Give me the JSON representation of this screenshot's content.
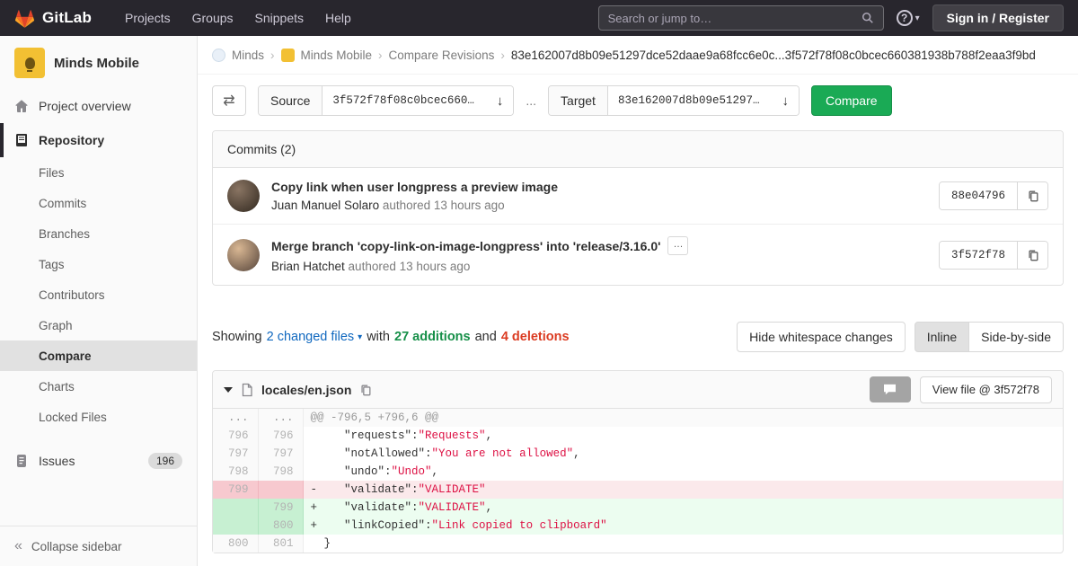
{
  "colors": {
    "navbar_bg": "#28262d",
    "accent_green": "#1aaa55",
    "link_blue": "#1068bf",
    "addition_green": "#168f48",
    "deletion_red": "#db3b21",
    "avatar_yellow": "#f2c033"
  },
  "navbar": {
    "brand": "GitLab",
    "menu": [
      "Projects",
      "Groups",
      "Snippets",
      "Help"
    ],
    "search_placeholder": "Search or jump to…",
    "auth_button": "Sign in / Register"
  },
  "sidebar": {
    "project_name": "Minds Mobile",
    "overview_label": "Project overview",
    "repository_label": "Repository",
    "repository_items": [
      "Files",
      "Commits",
      "Branches",
      "Tags",
      "Contributors",
      "Graph",
      "Compare",
      "Charts",
      "Locked Files"
    ],
    "active_item": "Compare",
    "issues_label": "Issues",
    "issues_count": "196",
    "collapse_label": "Collapse sidebar"
  },
  "breadcrumb": {
    "items": [
      "Minds",
      "Minds Mobile",
      "Compare Revisions"
    ],
    "current": "83e162007d8b09e51297dce52daae9a68fcc6e0c...3f572f78f08c0bcec660381938b788f2eaa3f9bd"
  },
  "compare_form": {
    "source_label": "Source",
    "source_value": "3f572f78f08c0bcec660…",
    "separator": "...",
    "target_label": "Target",
    "target_value": "83e162007d8b09e51297…",
    "compare_button": "Compare"
  },
  "commits": {
    "header": "Commits (2)",
    "items": [
      {
        "title": "Copy link when user longpress a preview image",
        "author": "Juan Manuel Solaro",
        "meta": "authored 13 hours ago",
        "sha": "88e04796",
        "expander": false
      },
      {
        "title": "Merge branch 'copy-link-on-image-longpress' into 'release/3.16.0'",
        "author": "Brian Hatchet",
        "meta": "authored 13 hours ago",
        "sha": "3f572f78",
        "expander": true
      }
    ]
  },
  "diff_summary": {
    "showing": "Showing",
    "files_link": "2 changed files",
    "with_label": "with",
    "additions": "27 additions",
    "and_label": "and",
    "deletions": "4 deletions",
    "whitespace_button": "Hide whitespace changes",
    "inline_button": "Inline",
    "side_by_side_button": "Side-by-side"
  },
  "file_diff": {
    "file_name": "locales/en.json",
    "view_file_button": "View file @ 3f572f78",
    "lines": [
      {
        "type": "hunk",
        "old": "...",
        "new": "...",
        "sign": "",
        "parts": [
          [
            "h",
            "@@ -796,5 +796,6 @@"
          ]
        ]
      },
      {
        "type": "ctx",
        "old": "796",
        "new": "796",
        "sign": "",
        "parts": [
          [
            "k",
            "   \"requests\""
          ],
          [
            "p",
            ":"
          ],
          [
            "s",
            "\"Requests\""
          ],
          [
            "p",
            ","
          ]
        ]
      },
      {
        "type": "ctx",
        "old": "797",
        "new": "797",
        "sign": "",
        "parts": [
          [
            "k",
            "   \"notAllowed\""
          ],
          [
            "p",
            ":"
          ],
          [
            "s",
            "\"You are not allowed\""
          ],
          [
            "p",
            ","
          ]
        ]
      },
      {
        "type": "ctx",
        "old": "798",
        "new": "798",
        "sign": "",
        "parts": [
          [
            "k",
            "   \"undo\""
          ],
          [
            "p",
            ":"
          ],
          [
            "s",
            "\"Undo\""
          ],
          [
            "p",
            ","
          ]
        ]
      },
      {
        "type": "del",
        "old": "799",
        "new": "",
        "sign": "-",
        "parts": [
          [
            "k",
            "   \"validate\""
          ],
          [
            "p",
            ":"
          ],
          [
            "s",
            "\"VALIDATE\""
          ]
        ]
      },
      {
        "type": "add",
        "old": "",
        "new": "799",
        "sign": "+",
        "parts": [
          [
            "k",
            "   \"validate\""
          ],
          [
            "p",
            ":"
          ],
          [
            "s",
            "\"VALIDATE\""
          ],
          [
            "p",
            ","
          ]
        ]
      },
      {
        "type": "add",
        "old": "",
        "new": "800",
        "sign": "+",
        "parts": [
          [
            "k",
            "   \"linkCopied\""
          ],
          [
            "p",
            ":"
          ],
          [
            "s",
            "\"Link copied to clipboard\""
          ]
        ]
      },
      {
        "type": "ctx",
        "old": "800",
        "new": "801",
        "sign": "",
        "parts": [
          [
            "n",
            "}"
          ]
        ]
      }
    ]
  }
}
